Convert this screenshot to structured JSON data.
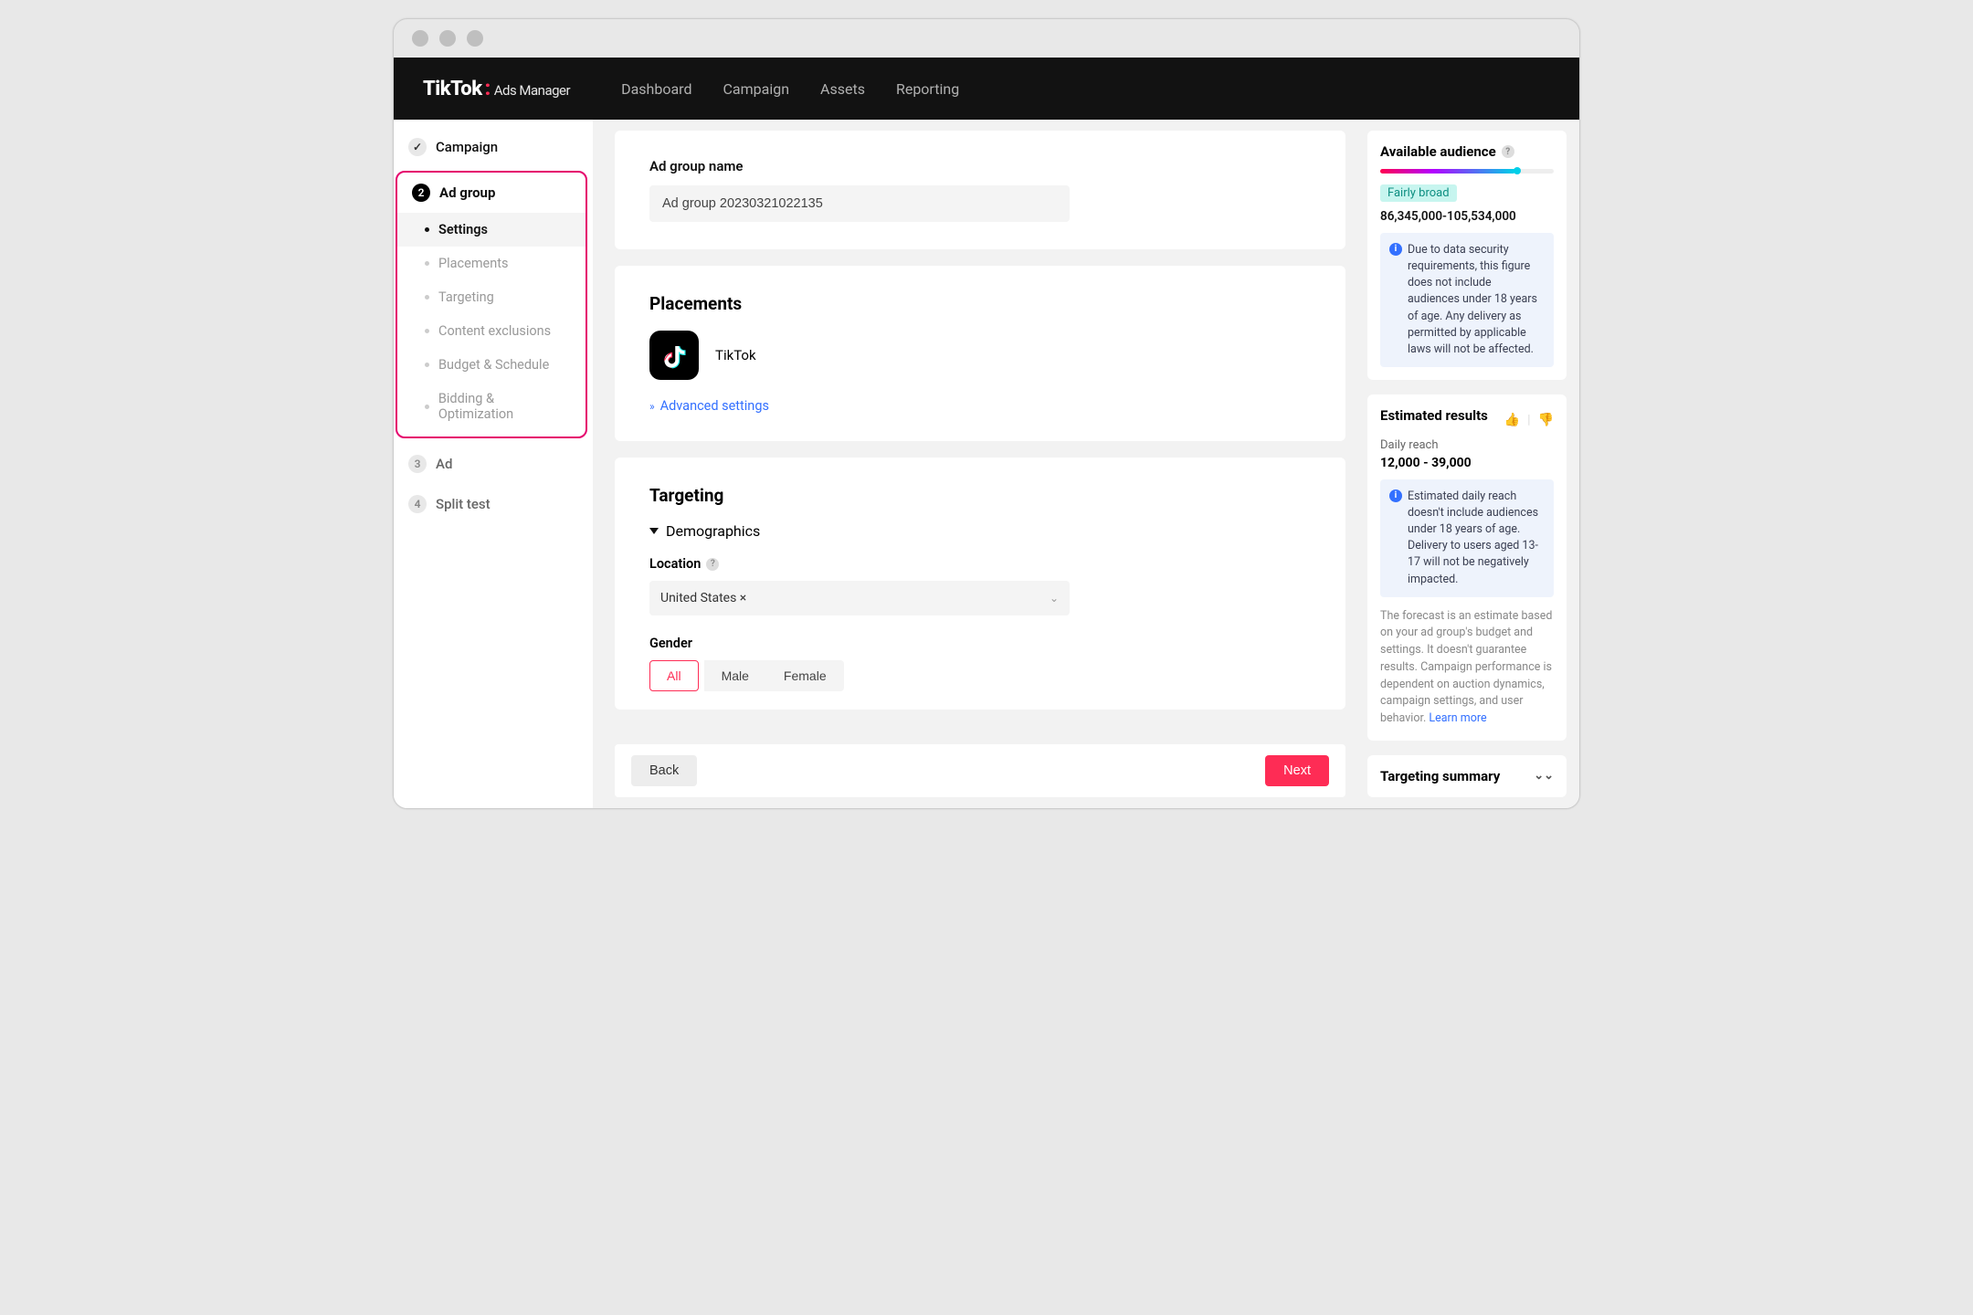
{
  "brand": {
    "name": "TikTok",
    "sub": "Ads Manager"
  },
  "nav": [
    "Dashboard",
    "Campaign",
    "Assets",
    "Reporting"
  ],
  "steps": {
    "campaign": "Campaign",
    "adgroup": "Ad group",
    "ad": "Ad",
    "splittest": "Split test",
    "num2": "2",
    "num3": "3",
    "num4": "4"
  },
  "subnav": [
    "Settings",
    "Placements",
    "Targeting",
    "Content exclusions",
    "Budget & Schedule",
    "Bidding & Optimization"
  ],
  "adgroup": {
    "name_label": "Ad group name",
    "name_value": "Ad group 20230321022135"
  },
  "placements": {
    "title": "Placements",
    "tiktok": "TikTok",
    "advanced": "Advanced settings"
  },
  "targeting": {
    "title": "Targeting",
    "demographics": "Demographics",
    "location_label": "Location",
    "location_value": "United States ×",
    "gender_label": "Gender",
    "gender_options": [
      "All",
      "Male",
      "Female"
    ]
  },
  "footer": {
    "back": "Back",
    "next": "Next"
  },
  "audience": {
    "title": "Available audience",
    "chip": "Fairly broad",
    "range": "86,345,000-105,534,000",
    "info": "Due to data security requirements, this figure does not include audiences under 18 years of age. Any delivery as permitted by applicable laws will not be affected."
  },
  "estimated": {
    "title": "Estimated results",
    "reach_label": "Daily reach",
    "reach_value": "12,000 - 39,000",
    "info": "Estimated daily reach doesn't include audiences under 18 years of age. Delivery to users aged 13-17 will not be negatively impacted.",
    "forecast": "The forecast is an estimate based on your ad group's budget and settings. It doesn't guarantee results. Campaign performance is dependent on auction dynamics, campaign settings, and user behavior. ",
    "learn": "Learn more"
  },
  "tsummary": "Targeting summary"
}
